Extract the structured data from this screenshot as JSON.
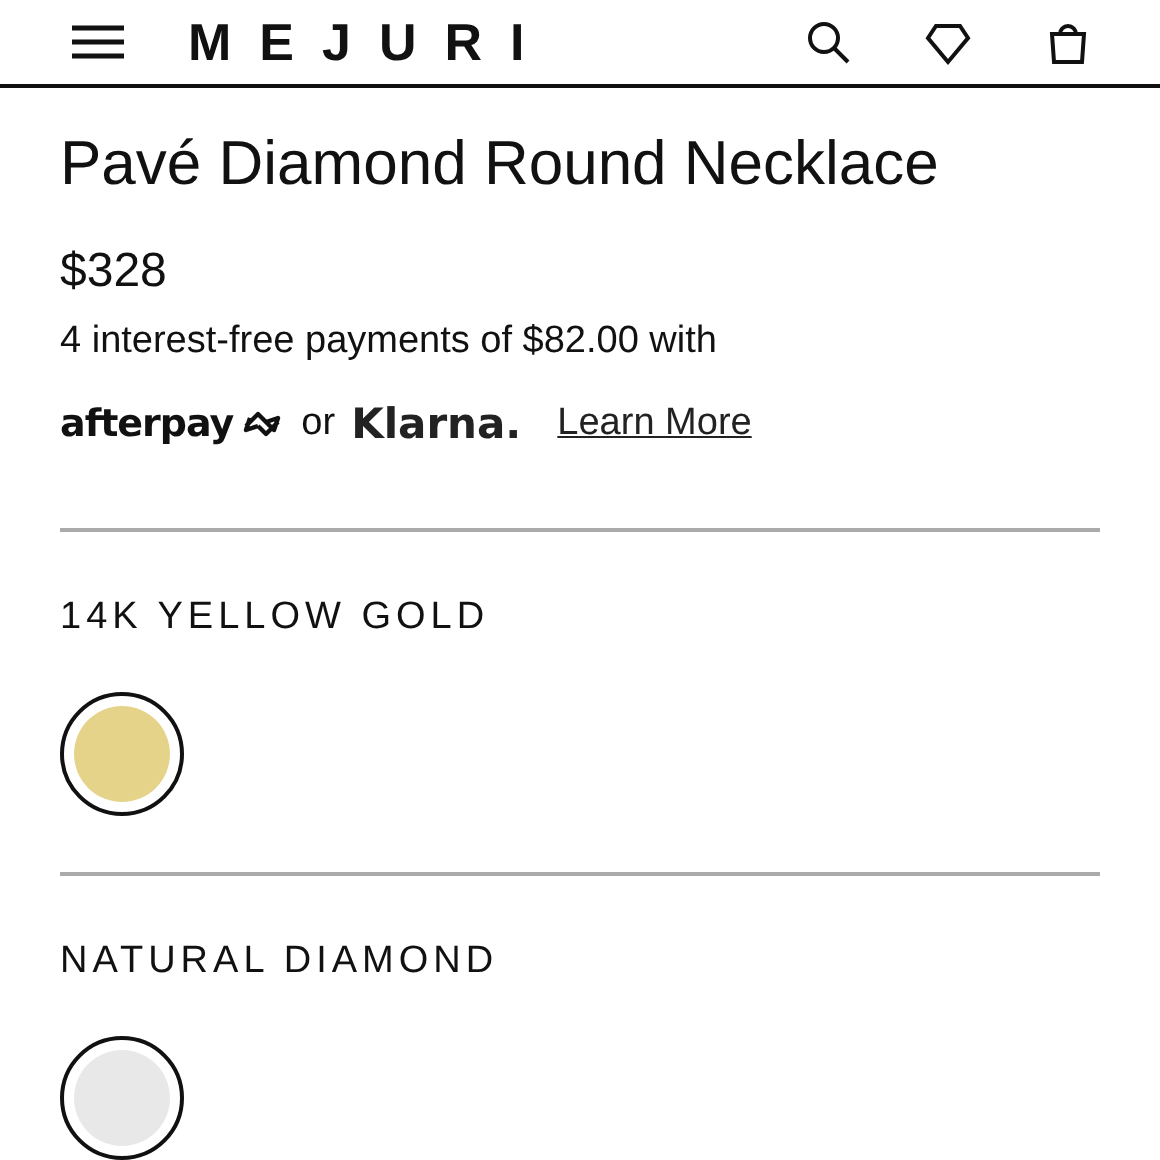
{
  "header": {
    "logo": "MEJURI"
  },
  "product": {
    "title": "Pavé Diamond Round Necklace",
    "price": "$328",
    "installments": "4 interest-free payments of $82.00 with",
    "afterpay": "afterpay",
    "or": "or",
    "klarna": "Klarna.",
    "learn_more": "Learn More"
  },
  "options": [
    {
      "label": "14K YELLOW GOLD",
      "swatches": [
        {
          "color": "#e6d38a",
          "selected": true
        }
      ]
    },
    {
      "label": "NATURAL DIAMOND",
      "swatches": [
        {
          "color": "#e8e8e8",
          "selected": true
        }
      ]
    }
  ]
}
